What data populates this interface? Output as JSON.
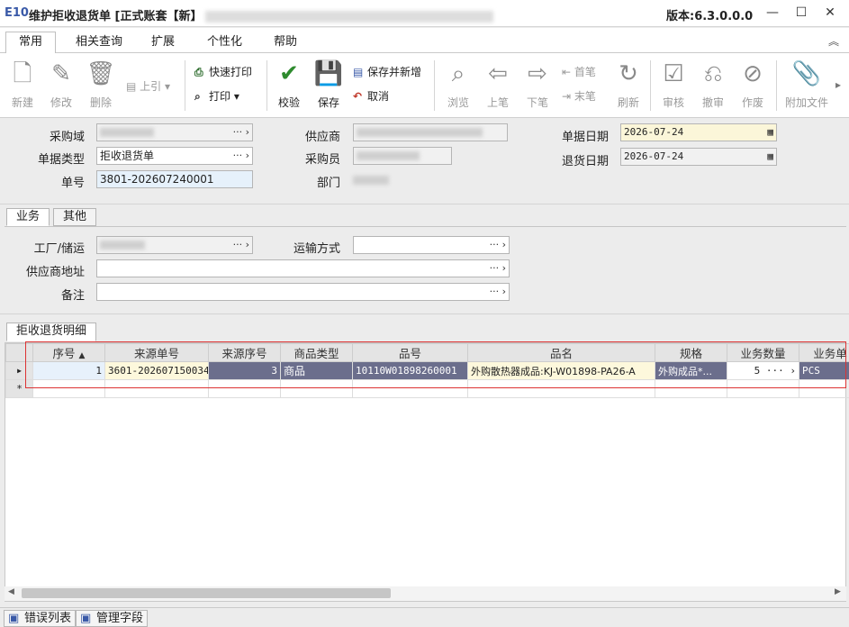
{
  "window": {
    "logo": "E10",
    "title": "维护拒收退货单 [正式账套【新】",
    "version": "版本:6.3.0.0.0",
    "controls": [
      "—",
      "☐",
      "✕"
    ]
  },
  "menu_tabs": [
    "常用",
    "相关查询",
    "扩展",
    "个性化",
    "帮助"
  ],
  "toolbar": {
    "new": "新建",
    "edit": "修改",
    "delete": "删除",
    "pull": "上引",
    "quick_print": "快速打印",
    "print": "打印",
    "check": "校验",
    "save": "保存",
    "save_new": "保存并新增",
    "cancel": "取消",
    "browse": "浏览",
    "prev": "上笔",
    "next": "下笔",
    "first": "首笔",
    "last": "末笔",
    "refresh": "刷新",
    "approve": "审核",
    "unapprove": "撤审",
    "void": "作废",
    "attach": "附加文件"
  },
  "header": {
    "purchase_domain_label": "采购域",
    "doc_type_label": "单据类型",
    "doc_type_value": "拒收退货单",
    "doc_no_label": "单号",
    "doc_no_value": "3801-202607240001",
    "supplier_label": "供应商",
    "buyer_label": "采购员",
    "dept_label": "部门",
    "doc_date_label": "单据日期",
    "doc_date_value": "2026-07-24",
    "return_date_label": "退货日期",
    "return_date_value": "2026-07-24"
  },
  "subtabs": [
    "业务",
    "其他"
  ],
  "business": {
    "plant_label": "工厂/储运",
    "transport_label": "运输方式",
    "supplier_addr_label": "供应商地址",
    "remark_label": "备注"
  },
  "detail_tab": "拒收退货明细",
  "grid": {
    "columns": [
      "序号",
      "来源单号",
      "来源序号",
      "商品类型",
      "品号",
      "品名",
      "规格",
      "业务数量",
      "业务单"
    ],
    "rows": [
      [
        "1",
        "3601-202607150034",
        "3",
        "商品",
        "10110W01898260001",
        "外购散热器成品:KJ-W01898-PA26-A",
        "外购成品*...",
        "5",
        "PCS"
      ]
    ],
    "new_row_marker": "*"
  },
  "status_tabs": [
    "错误列表",
    "管理字段"
  ]
}
